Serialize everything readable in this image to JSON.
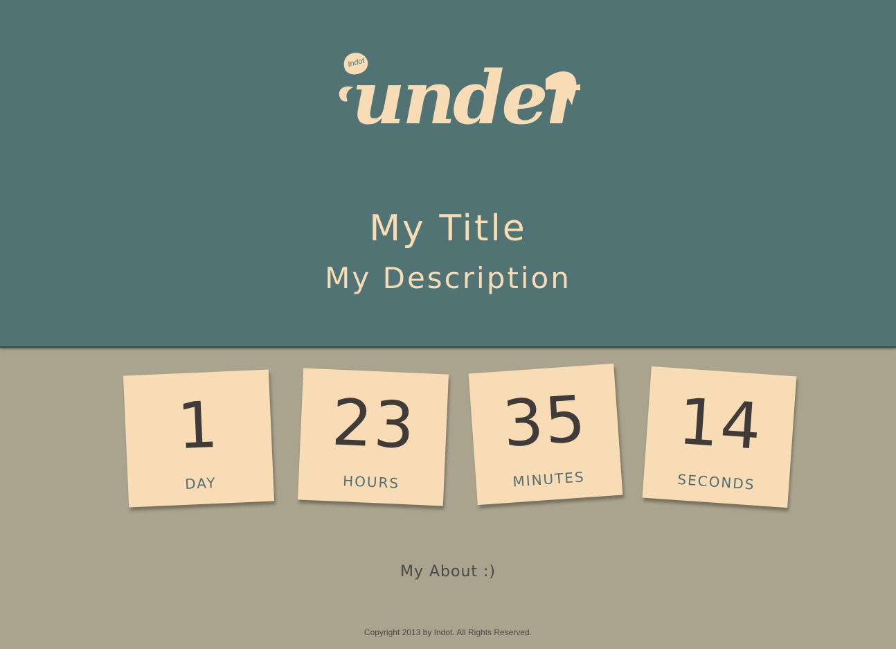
{
  "brand": {
    "logo_badge": "Indot",
    "logo_text": "under"
  },
  "hero": {
    "title": "My Title",
    "description": "My Description"
  },
  "countdown": [
    {
      "value": "1",
      "unit": "DAY"
    },
    {
      "value": "23",
      "unit": "HOURS"
    },
    {
      "value": "35",
      "unit": "MINUTES"
    },
    {
      "value": "14",
      "unit": "SECONDS"
    }
  ],
  "about": "My About :)",
  "footer": {
    "copyright": "Copyright 2013 by Indot. All Rights Reserved."
  },
  "colors": {
    "header_bg": "#517374",
    "body_bg": "#aaa48f",
    "card_bg": "#f7dcb5",
    "accent_text": "#f7dcb5",
    "number_text": "#403a39",
    "unit_text": "#556e72"
  }
}
